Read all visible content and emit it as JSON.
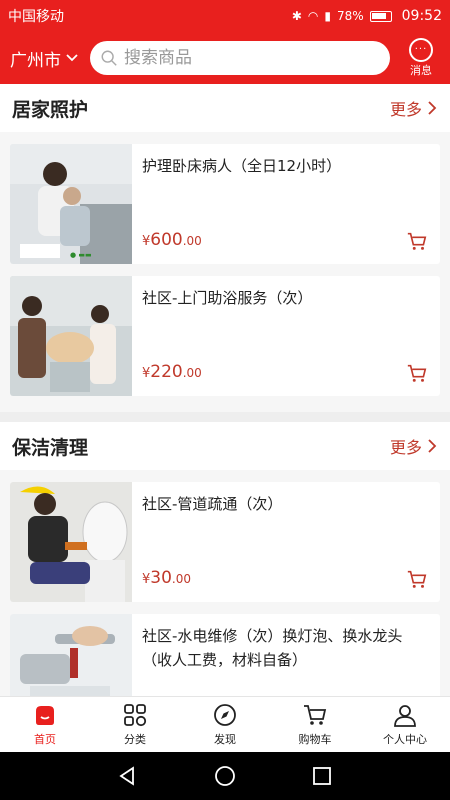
{
  "status_bar": {
    "carrier": "中国移动",
    "battery": "78%",
    "time": "09:52"
  },
  "header": {
    "city": "广州市",
    "search_placeholder": "搜索商品",
    "message_label": "消息"
  },
  "sections": [
    {
      "title": "居家照护",
      "more": "更多",
      "items": [
        {
          "name": "护理卧床病人（全日12小时）",
          "currency": "¥",
          "price_int": "600",
          "price_dec": ".00"
        },
        {
          "name": "社区-上门助浴服务（次）",
          "currency": "¥",
          "price_int": "220",
          "price_dec": ".00"
        }
      ]
    },
    {
      "title": "保洁清理",
      "more": "更多",
      "items": [
        {
          "name": "社区-管道疏通（次）",
          "currency": "¥",
          "price_int": "30",
          "price_dec": ".00"
        },
        {
          "name": "社区-水电维修（次）换灯泡、换水龙头（收人工费，材料自备）",
          "currency": "",
          "price_int": "",
          "price_dec": ""
        }
      ]
    }
  ],
  "tabs": [
    {
      "label": "首页",
      "icon": "home-icon",
      "active": true
    },
    {
      "label": "分类",
      "icon": "grid-icon",
      "active": false
    },
    {
      "label": "发现",
      "icon": "compass-icon",
      "active": false
    },
    {
      "label": "购物车",
      "icon": "cart-icon",
      "active": false
    },
    {
      "label": "个人中心",
      "icon": "user-icon",
      "active": false
    }
  ],
  "colors": {
    "brand": "#e8201e",
    "price": "#c0392b"
  }
}
